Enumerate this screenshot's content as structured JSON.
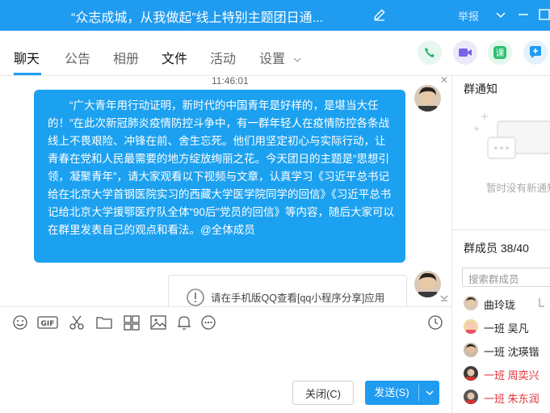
{
  "window": {
    "title": "“众志成城，从我做起”线上特别主题团日通...",
    "report_label": "举报"
  },
  "tabs": [
    {
      "label": "聊天"
    },
    {
      "label": "公告"
    },
    {
      "label": "相册"
    },
    {
      "label": "文件"
    },
    {
      "label": "活动"
    },
    {
      "label": "设置"
    }
  ],
  "colors": {
    "accent": "#1f9bf0",
    "bubble": "#1ca1f0",
    "mention_red": "#e0353a"
  },
  "chat": {
    "timestamp": "11:46:01",
    "message": "“广大青年用行动证明，新时代的中国青年是好样的，是堪当大任的！”在此次新冠肺炎疫情防控斗争中，有一群年轻人在疫情防控各条战线上不畏艰险、冲锋在前、舍生忘死。他们用坚定初心与实际行动，让青春在党和人民最需要的地方绽放绚丽之花。今天团日的主题是“思想引领，凝聚青年”，请大家观看以下视频与文章，认真学习《习近平总书记给在北京大学首钢医院实习的西藏大学医学院同学的回信》《习近平总书记给北京大学援鄂医疗队全体“90后”党员的回信》等内容，随后大家可以在群里发表自己的观点和看法。@全体成员",
    "card_text": "请在手机版QQ查看[qq小程序分享]应用"
  },
  "input": {
    "close_label": "关闭(C)",
    "send_label": "发送(S)"
  },
  "sidebar": {
    "notice_title": "群通知",
    "notice_empty": "暂时没有新通知",
    "members_title": "群成员 38/40",
    "search_placeholder": "搜索群成员",
    "members": [
      {
        "name": "曲玲珑",
        "red": false
      },
      {
        "name": "一班 吴凡",
        "red": false
      },
      {
        "name": "一班 沈瑛锴",
        "red": false
      },
      {
        "name": "一班 周奕兴",
        "red": true
      },
      {
        "name": "一班 朱东润",
        "red": true
      }
    ]
  }
}
